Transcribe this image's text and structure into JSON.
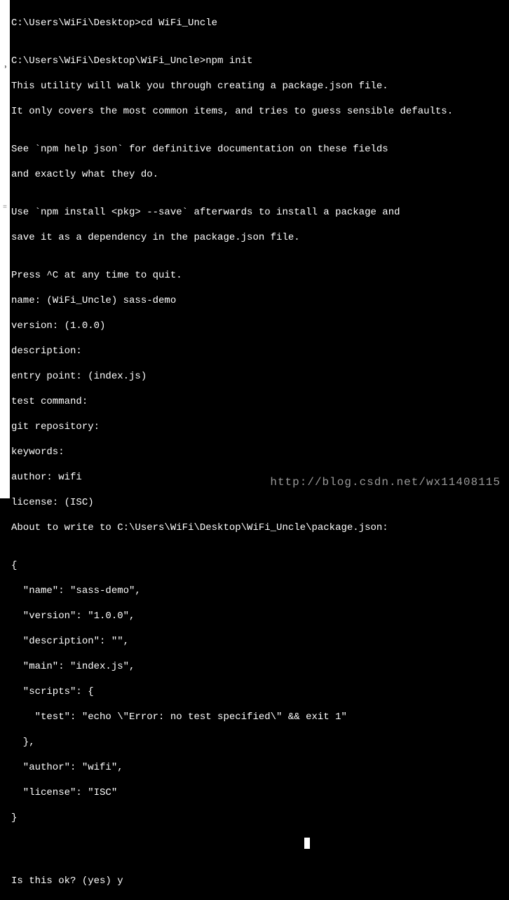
{
  "gutter": {
    "top_icon": "◑",
    "mid_icon": "="
  },
  "lines": {
    "l0": "C:\\Users\\WiFi\\Desktop>cd WiFi_Uncle",
    "l1": "",
    "l2": "C:\\Users\\WiFi\\Desktop\\WiFi_Uncle>npm init",
    "l3": "This utility will walk you through creating a package.json file.",
    "l4": "It only covers the most common items, and tries to guess sensible defaults.",
    "l5": "",
    "l6": "See `npm help json` for definitive documentation on these fields",
    "l7": "and exactly what they do.",
    "l8": "",
    "l9": "Use `npm install <pkg> --save` afterwards to install a package and",
    "l10": "save it as a dependency in the package.json file.",
    "l11": "",
    "l12": "Press ^C at any time to quit.",
    "l13": "name: (WiFi_Uncle) sass-demo",
    "l14": "version: (1.0.0)",
    "l15": "description:",
    "l16": "entry point: (index.js)",
    "l17": "test command:",
    "l18": "git repository:",
    "l19": "keywords:",
    "l20": "author: wifi",
    "l21": "license: (ISC)",
    "l22": "About to write to C:\\Users\\WiFi\\Desktop\\WiFi_Uncle\\package.json:",
    "l23": "",
    "l24": "{",
    "l25": "  \"name\": \"sass-demo\",",
    "l26": "  \"version\": \"1.0.0\",",
    "l27": "  \"description\": \"\",",
    "l28": "  \"main\": \"index.js\",",
    "l29": "  \"scripts\": {",
    "l30": "    \"test\": \"echo \\\"Error: no test specified\\\" && exit 1\"",
    "l31": "  },",
    "l32": "  \"author\": \"wifi\",",
    "l33": "  \"license\": \"ISC\"",
    "l34": "}",
    "l35": "",
    "l36": "",
    "l37": "Is this ok? (yes) y"
  },
  "watermark": "http://blog.csdn.net/wx11408115"
}
